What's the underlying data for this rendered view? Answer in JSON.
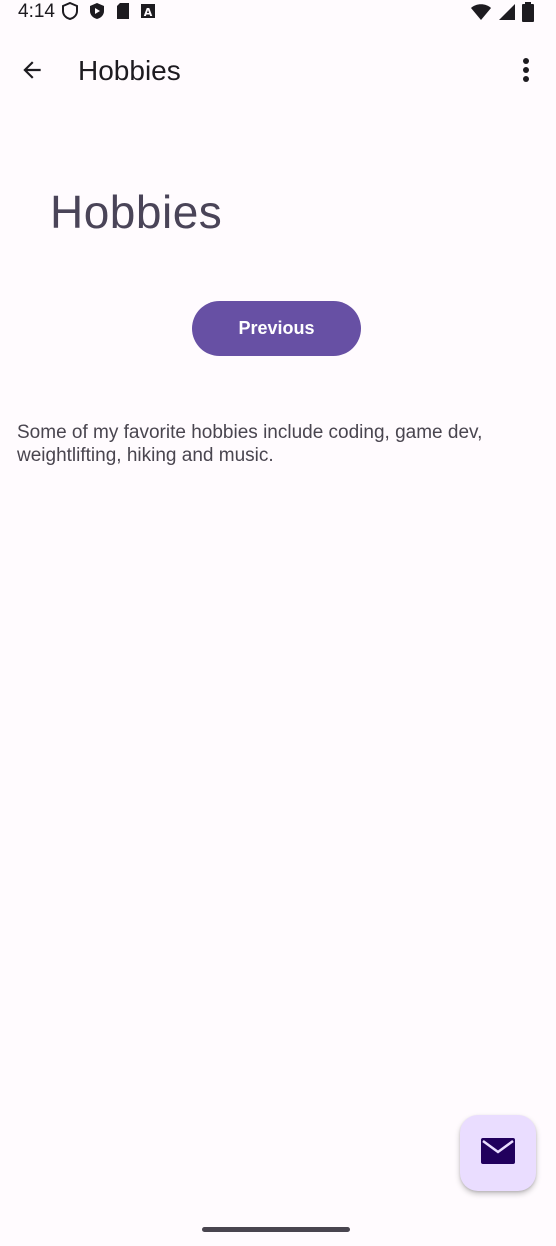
{
  "status_bar": {
    "time": "4:14",
    "left_icons": [
      "shield-icon",
      "play-protect-icon",
      "sd-card-icon",
      "keyboard-a-icon"
    ],
    "right_icons": [
      "wifi-icon",
      "cell-signal-icon",
      "battery-icon"
    ]
  },
  "app_bar": {
    "title": "Hobbies",
    "back_icon": "arrow-back-icon",
    "overflow_icon": "more-vert-icon"
  },
  "content": {
    "heading": "Hobbies",
    "previous_label": "Previous",
    "body": "Some of my favorite hobbies include coding, game dev, weightlifting, hiking and music."
  },
  "fab": {
    "icon": "mail-icon"
  },
  "colors": {
    "primary": "#6750a4",
    "fab_container": "#eaddff",
    "background": "#fffbfe",
    "on_surface": "#1d1b20"
  }
}
